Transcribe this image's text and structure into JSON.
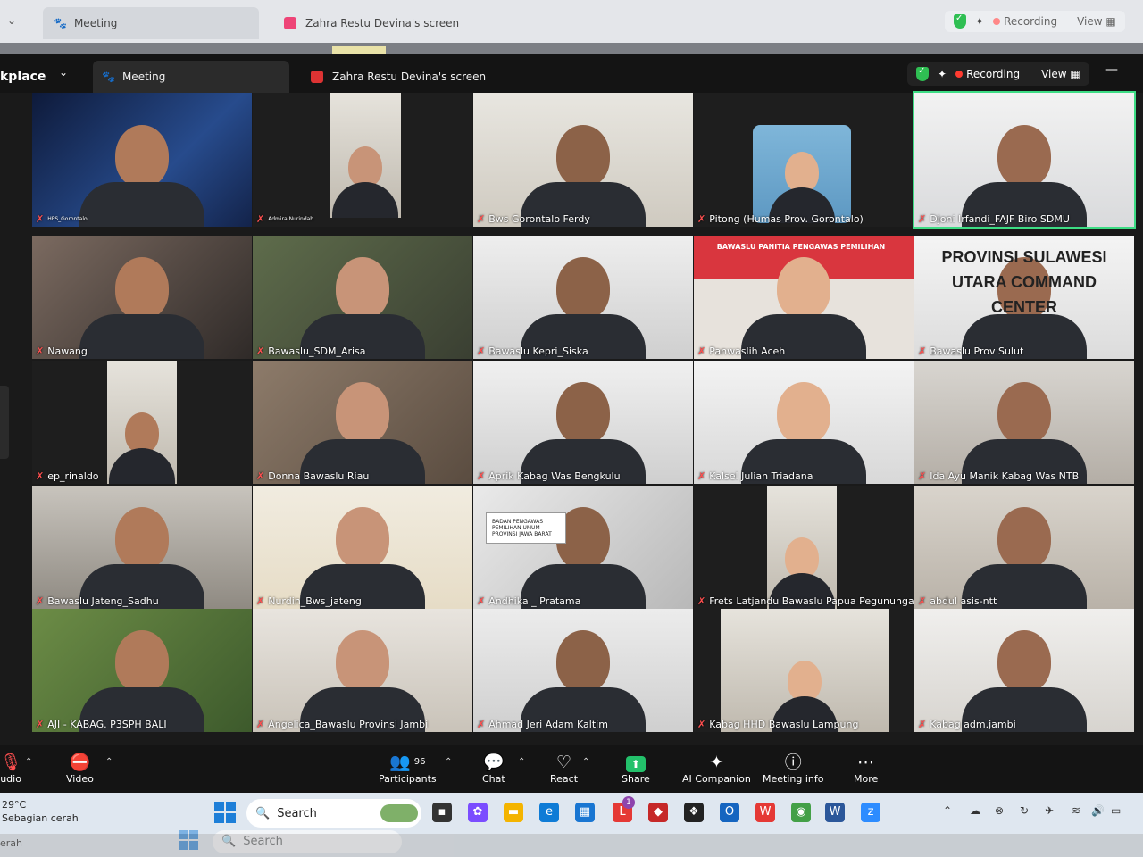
{
  "outer": {
    "tab_meeting": "Meeting",
    "tab_share": "Zahra Restu Devina's screen",
    "recording": "Recording",
    "view": "View"
  },
  "window": {
    "app_partial": "kplace",
    "tab_meeting": "Meeting",
    "tab_share": "Zahra Restu Devina's screen",
    "recording": "Recording",
    "view": "View",
    "minimize": "—"
  },
  "participants": [
    {
      "name": "HPS_Gorontalo"
    },
    {
      "name": "Admira Nurindah"
    },
    {
      "name": "Bws Gorontalo Ferdy"
    },
    {
      "name": "Pitong (Humas Prov. Gorontalo)"
    },
    {
      "name": "Djoni Irfandi_FAJF Biro SDMU"
    },
    {
      "name": "Nawang"
    },
    {
      "name": "Bawaslu_SDM_Arisa"
    },
    {
      "name": "Bawaslu Kepri_Siska"
    },
    {
      "name": "Panwaslih Aceh",
      "banner": "BAWASLU PANITIA PENGAWAS PEMILIHAN"
    },
    {
      "name": "Bawaslu Prov Sulut",
      "banner": "PROVINSI SULAWESI UTARA COMMAND CENTER"
    },
    {
      "name": "ep_rinaldo"
    },
    {
      "name": "Donna Bawaslu Riau"
    },
    {
      "name": "Aprik Kabag Was Bengkulu"
    },
    {
      "name": "Kalsel Julian Triadana"
    },
    {
      "name": "Ida Ayu Manik Kabag Was NTB"
    },
    {
      "name": "Bawaslu Jateng_Sadhu"
    },
    {
      "name": "Nurdin_Bws_jateng"
    },
    {
      "name": "Andhika _ Pratama",
      "banner": "BADAN PENGAWAS PEMILIHAN UMUM PROVINSI JAWA BARAT"
    },
    {
      "name": "Frets Latjandu Bawaslu Papua Pegunungan"
    },
    {
      "name": "abdul asis-ntt"
    },
    {
      "name": "AJI - KABAG. P3SPH BALI"
    },
    {
      "name": "Angelica_Bawaslu Provinsi Jambi"
    },
    {
      "name": "Ahmad Jeri Adam Kaltim"
    },
    {
      "name": "Kabag HHD Bawaslu Lampung"
    },
    {
      "name": "Kabag adm.jambi"
    }
  ],
  "toolbar": {
    "audio": "udio",
    "video": "Video",
    "participants": "Participants",
    "participants_count": "96",
    "chat": "Chat",
    "react": "React",
    "share": "Share",
    "ai": "AI Companion",
    "info": "Meeting info",
    "more": "More"
  },
  "taskbar": {
    "temp": "29°C",
    "weather": "Sebagian cerah",
    "search": "Search",
    "notif_badge": "1"
  },
  "taskbar_ghost": {
    "weather": "erah",
    "search": "Search"
  }
}
